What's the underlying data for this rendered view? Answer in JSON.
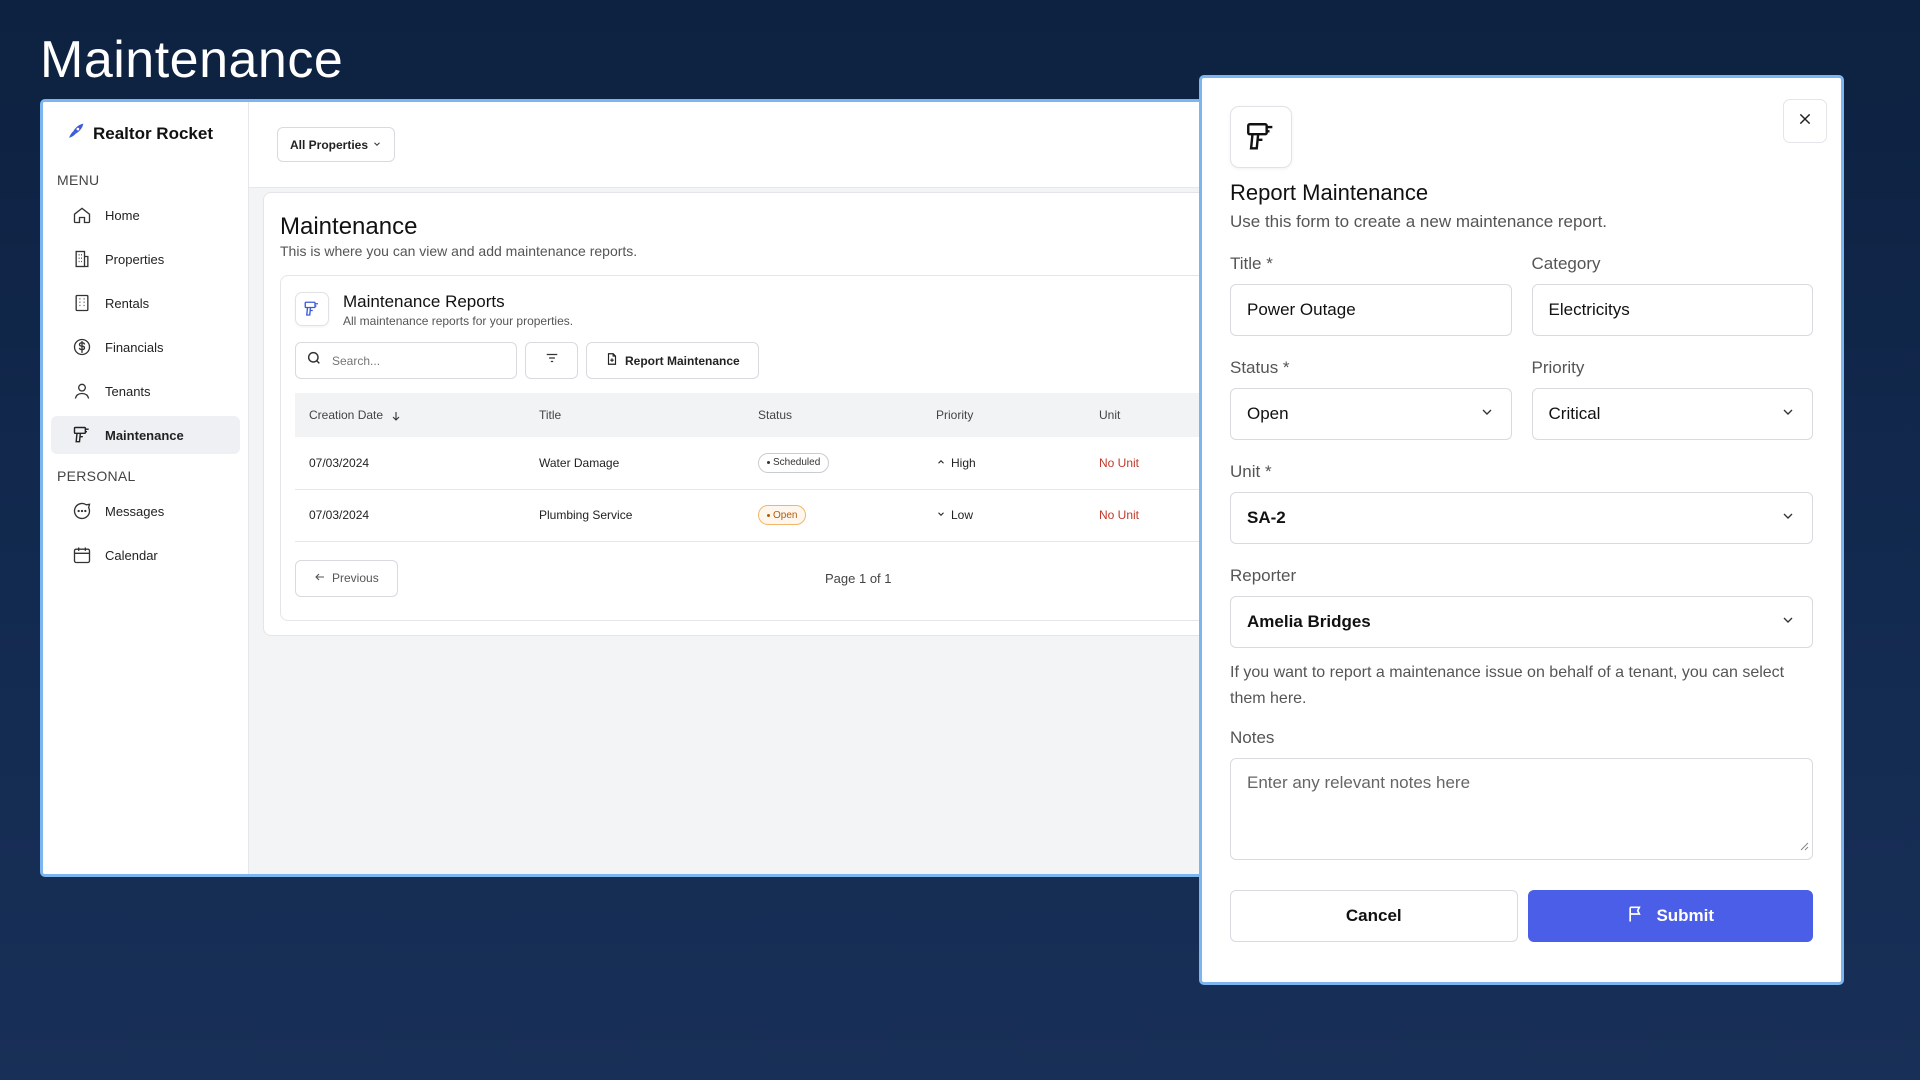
{
  "hero": {
    "title": "Maintenance"
  },
  "brand": {
    "name": "Realtor Rocket",
    "accent": "#3b5bdb"
  },
  "sidebar": {
    "menu_label": "MENU",
    "personal_label": "PERSONAL",
    "menu_items": [
      {
        "label": "Home",
        "icon": "home-icon"
      },
      {
        "label": "Properties",
        "icon": "building-icon"
      },
      {
        "label": "Rentals",
        "icon": "apartment-icon"
      },
      {
        "label": "Financials",
        "icon": "dollar-circle-icon"
      },
      {
        "label": "Tenants",
        "icon": "user-icon"
      },
      {
        "label": "Maintenance",
        "icon": "drill-icon",
        "active": true
      }
    ],
    "personal_items": [
      {
        "label": "Messages",
        "icon": "chat-icon"
      },
      {
        "label": "Calendar",
        "icon": "calendar-icon"
      }
    ]
  },
  "topbar": {
    "property_filter": "All Properties"
  },
  "page": {
    "title": "Maintenance",
    "subtitle": "This is where you can view and add maintenance reports."
  },
  "reports_card": {
    "title": "Maintenance Reports",
    "subtitle": "All maintenance reports for your properties.",
    "search_placeholder": "Search...",
    "report_button": "Report Maintenance",
    "columns": [
      "Creation Date",
      "Title",
      "Status",
      "Priority",
      "Unit"
    ],
    "rows": [
      {
        "date": "07/03/2024",
        "title": "Water Damage",
        "status": "Scheduled",
        "priority": "High",
        "unit": "No Unit"
      },
      {
        "date": "07/03/2024",
        "title": "Plumbing Service",
        "status": "Open",
        "priority": "Low",
        "unit": "No Unit"
      }
    ],
    "previous": "Previous",
    "page_info": "Page 1 of 1"
  },
  "modal": {
    "title": "Report Maintenance",
    "subtitle": "Use this form to create a new maintenance report.",
    "title_label": "Title *",
    "title_value": "Power Outage",
    "category_label": "Category",
    "category_value": "Electricitys",
    "status_label": "Status *",
    "status_value": "Open",
    "priority_label": "Priority",
    "priority_value": "Critical",
    "unit_label": "Unit *",
    "unit_value": "SA-2",
    "reporter_label": "Reporter",
    "reporter_value": "Amelia Bridges",
    "reporter_help": "If you want to report a maintenance issue on behalf of a tenant, you can select them here.",
    "notes_label": "Notes",
    "notes_placeholder": "Enter any relevant notes here",
    "cancel": "Cancel",
    "submit": "Submit",
    "submit_color": "#4a5ee8"
  }
}
